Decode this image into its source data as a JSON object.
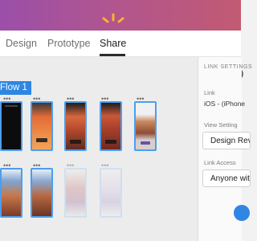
{
  "tabs": [
    {
      "label": "Design",
      "active": false
    },
    {
      "label": "Prototype",
      "active": false
    },
    {
      "label": "Share",
      "active": true
    }
  ],
  "icons": {
    "cloud": "cloud-icon",
    "user": "user-icon",
    "spark": "spark-icon"
  },
  "flow_label": "Flow 1",
  "panel": {
    "title": "LINK SETTINGS",
    "link_label": "Link",
    "link_value": "iOS - (iPhone",
    "view_setting_label": "View Setting",
    "view_setting_value": "Design Review",
    "link_access_label": "Link Access",
    "link_access_value": "Anyone with"
  },
  "colors": {
    "accent": "#2e86e3",
    "titlebar_start": "#9b4fa9",
    "titlebar_end": "#c25a72"
  },
  "artboard_row1": [
    {
      "screen": "black"
    },
    {
      "screen": "orange"
    },
    {
      "screen": "canyon"
    },
    {
      "screen": "red-rock"
    },
    {
      "screen": "rock-card"
    }
  ],
  "artboard_row2": [
    {
      "screen": "blue-canyon",
      "faded": false
    },
    {
      "screen": "blue-landscape",
      "faded": false
    },
    {
      "screen": "mauve",
      "faded": true
    },
    {
      "screen": "lilac",
      "faded": true
    }
  ]
}
